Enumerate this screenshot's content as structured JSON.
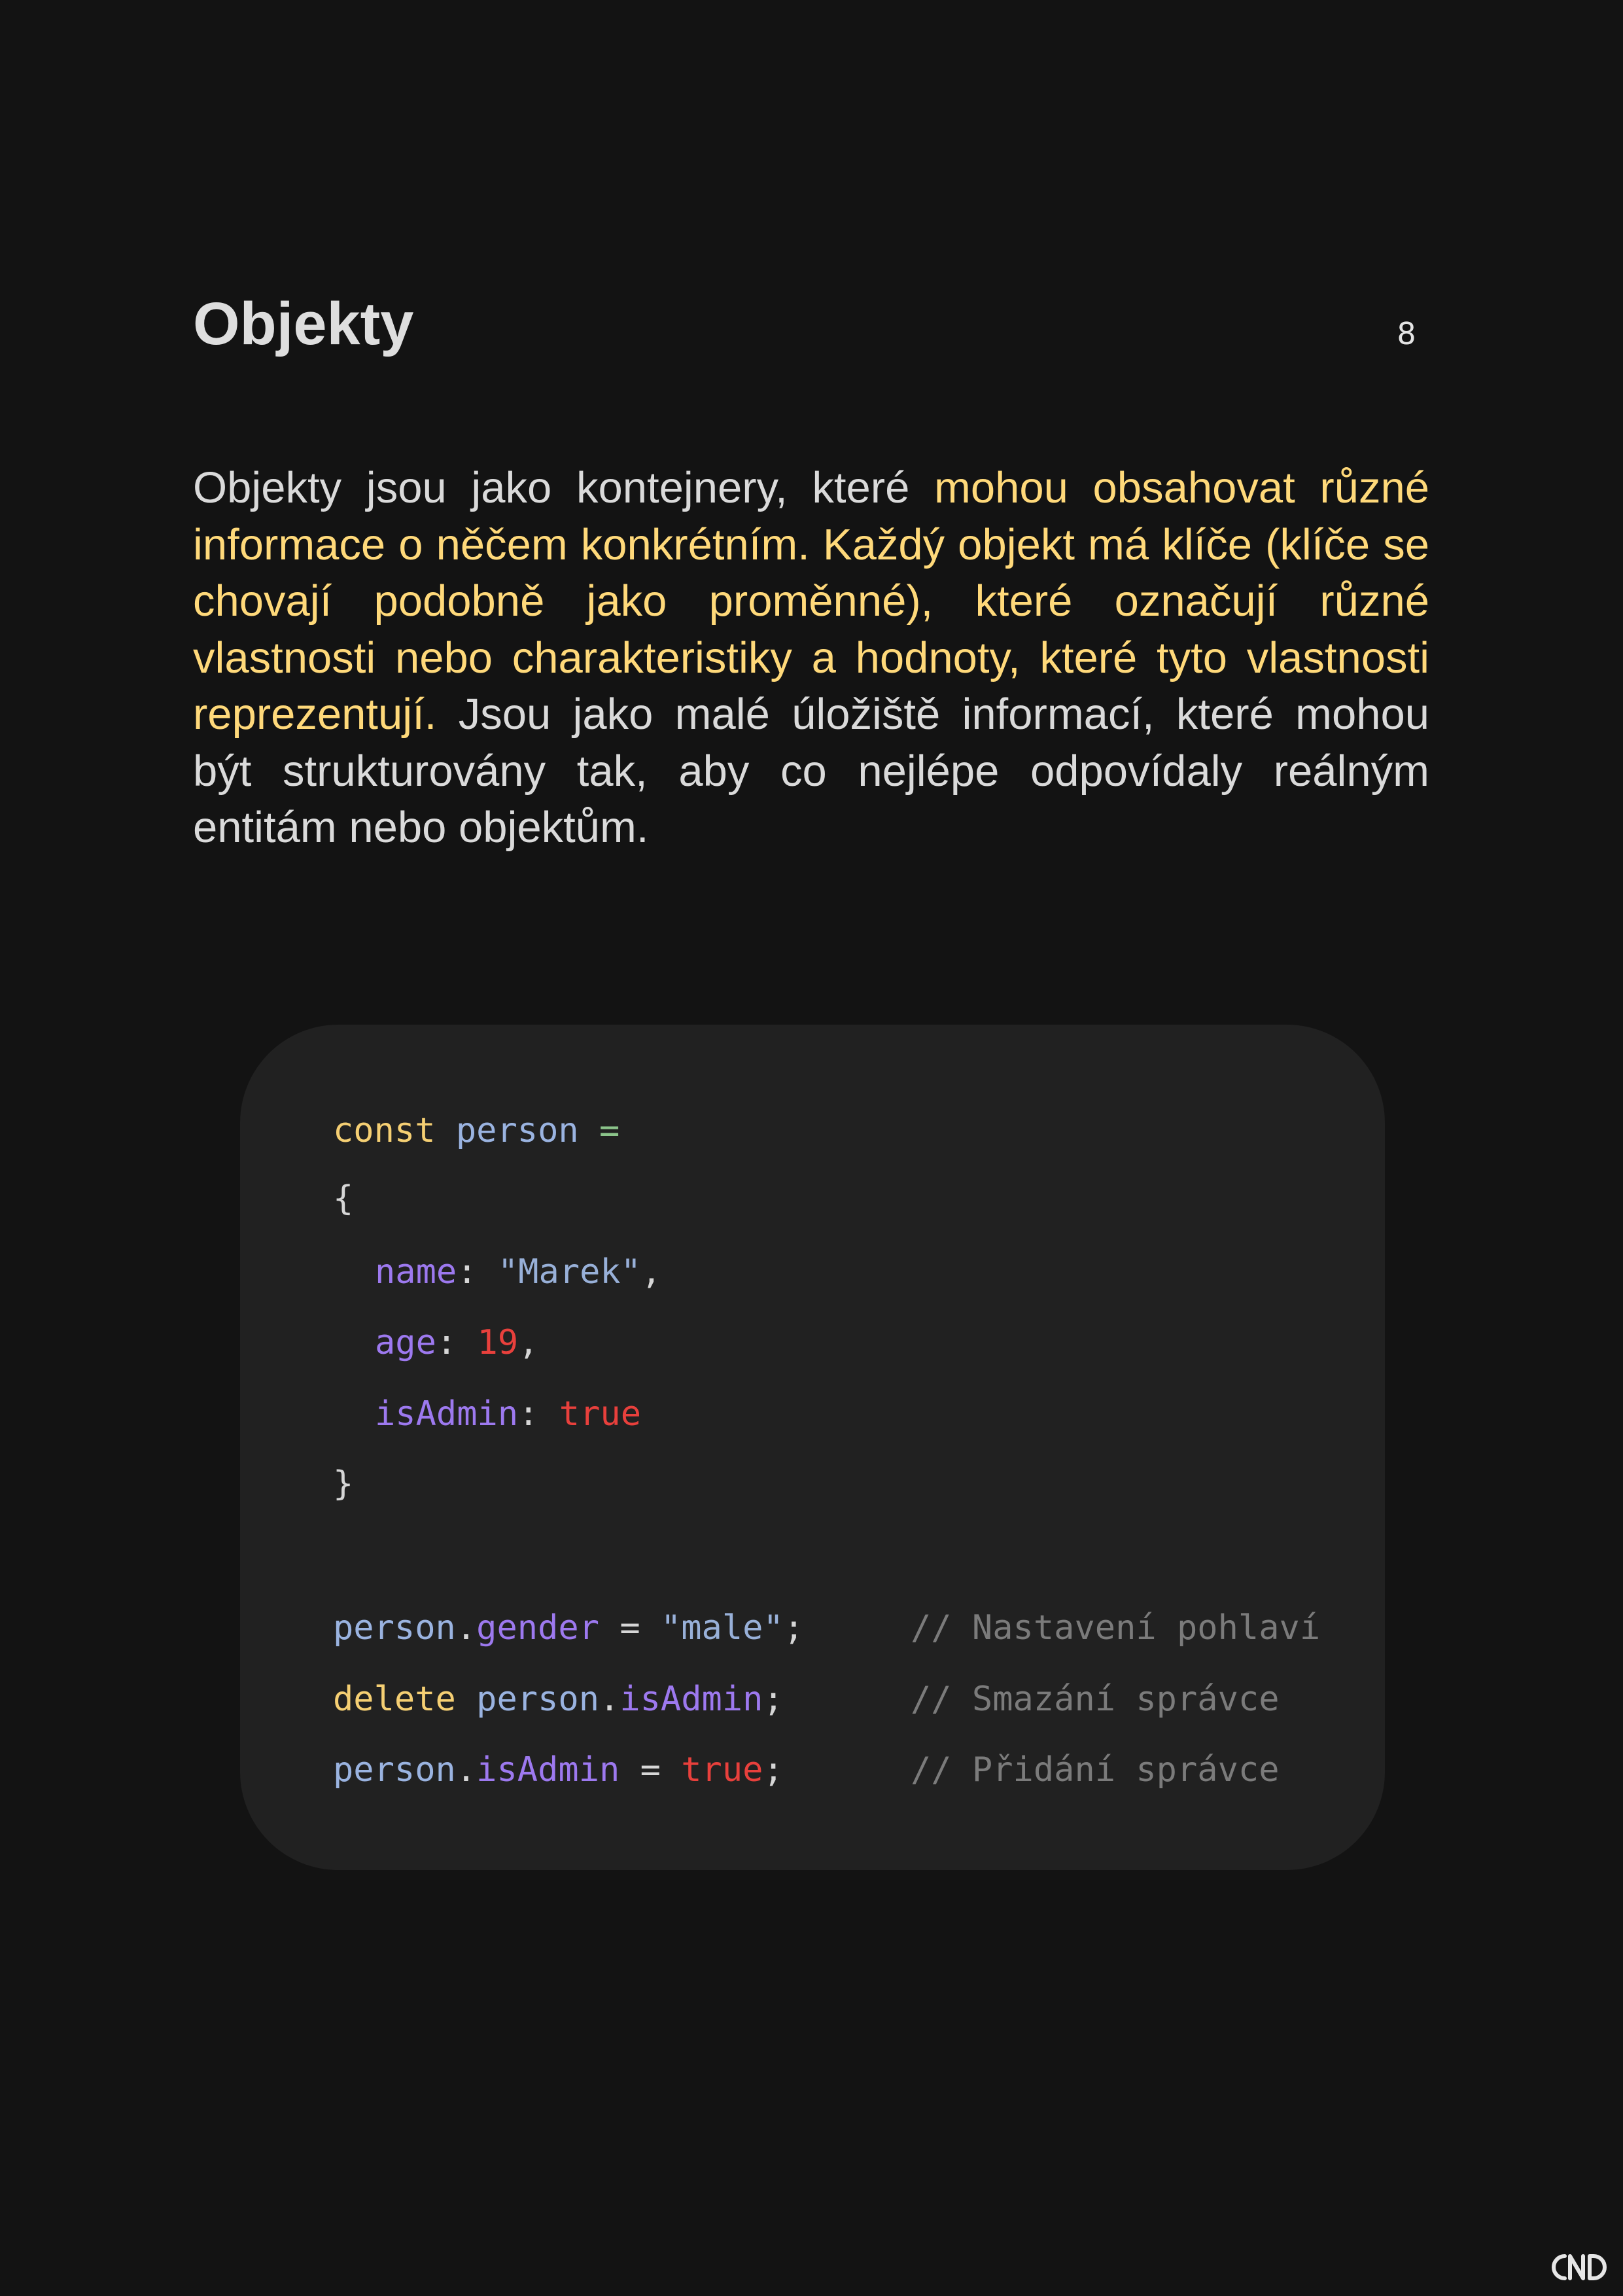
{
  "page": {
    "title": "Objekty",
    "number": "8"
  },
  "intro": {
    "segments": [
      {
        "text": "Objekty jsou jako kontejnery, které ",
        "highlight": false
      },
      {
        "text": "mohou obsahovat různé informace o něčem konkrétním. Každý objekt má klíče (klíče se chovají podobně jako proměnné), které označují různé vlastnosti nebo charakteristiky a hodnoty, které tyto vlastnosti reprezentují.",
        "highlight": true
      },
      {
        "text": " Jsou jako malé úložiště informací, které mohou být strukturovány tak, aby co nejlépe odpovídaly reálným entitám nebo objektům.",
        "highlight": false
      }
    ]
  },
  "code": {
    "line1": {
      "keyword": "const",
      "name": "person",
      "op": "="
    },
    "open_brace": "{",
    "field1": {
      "key": "name",
      "colon": ":",
      "value": "\"Marek\"",
      "comma": ","
    },
    "field2": {
      "key": "age",
      "colon": ":",
      "value": "19",
      "comma": ","
    },
    "field3": {
      "key": "isAdmin",
      "colon": ":",
      "value": "true"
    },
    "close_brace": "}",
    "stmt1": {
      "object": "person",
      "dot": ".",
      "prop": "gender",
      "op": "=",
      "value": "\"male\"",
      "semi": ";",
      "comment": "// Nastavení pohlaví"
    },
    "stmt2": {
      "keyword": "delete",
      "object": "person",
      "dot": ".",
      "prop": "isAdmin",
      "semi": ";",
      "comment": "// Smazání správce"
    },
    "stmt3": {
      "object": "person",
      "dot": ".",
      "prop": "isAdmin",
      "op": "=",
      "value": "true",
      "semi": ";",
      "comment": "// Přidání správce"
    }
  },
  "colors": {
    "background": "#131313",
    "card": "#212121",
    "highlight": "#ffd97a",
    "keyword": "#f5cf73",
    "property": "#9d79ef",
    "variable": "#9ab3e0",
    "literal": "#e8403c",
    "comment": "#7b7b7b"
  },
  "icons": {
    "logo": "cnd-logo-icon"
  }
}
